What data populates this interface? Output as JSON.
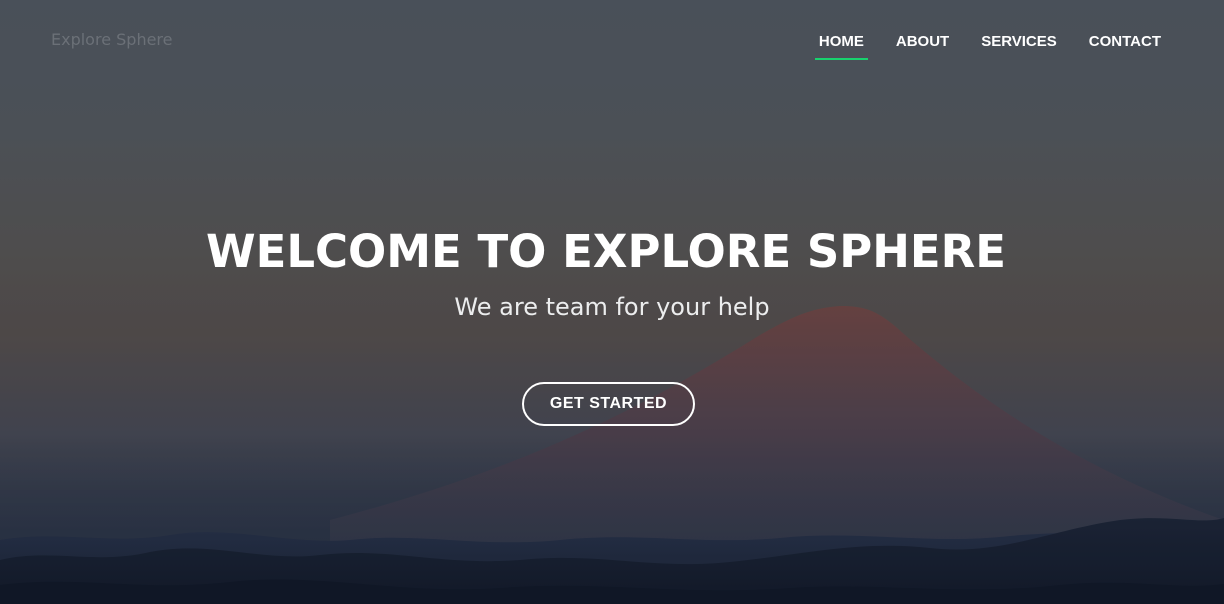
{
  "header": {
    "logo_text": "Explore Sphere",
    "nav": [
      {
        "label": "HOME",
        "active": true
      },
      {
        "label": "ABOUT",
        "active": false
      },
      {
        "label": "SERVICES",
        "active": false
      },
      {
        "label": "CONTACT",
        "active": false
      }
    ]
  },
  "hero": {
    "title": "WELCOME TO EXPLORE SPHERE",
    "subtitle": "We are team for your help",
    "cta_label": "GET STARTED",
    "background_image": "mountain-landscape"
  },
  "colors": {
    "accent": "#18d26e",
    "text": "#ffffff",
    "logo": "#6b7077"
  }
}
